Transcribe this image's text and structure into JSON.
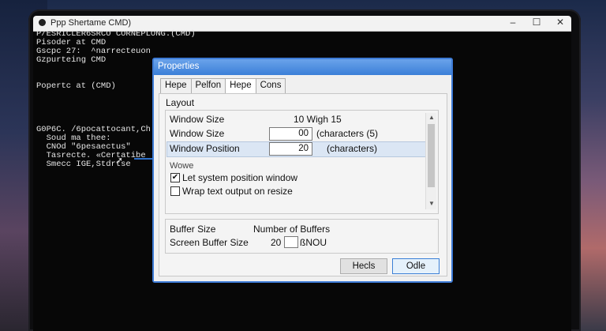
{
  "cmd_window": {
    "title": "Ppp Shertame CMD)",
    "controls": {
      "minimize": "–",
      "maximize": "☐",
      "close": "✕"
    },
    "console_lines": [
      "P/ESRICLER6SRCO CORNEPLONG.(CMD)",
      "Pisoder at CMD",
      "Gscpc 27:  ^narrecteuon",
      "Gzpurteing CMD",
      "",
      "",
      "Popertc at (CMD)",
      "",
      "",
      "",
      "",
      "G0P6C. /6pocattocant,Ch",
      "  Soud ma thee:",
      "  CNOd \"6pesaectus\"",
      "  Tasrecte. «Certatibe",
      "  Smecc IGE,Stdrtse"
    ]
  },
  "dialog": {
    "title": "Properties",
    "tabs": [
      "Hepe",
      "Pelfon",
      "Hepe",
      "Cons"
    ],
    "layout_label": "Layout",
    "rows": [
      {
        "label": "Window Size",
        "value": "10 Wigh 15"
      },
      {
        "label": "Window Size",
        "field": "00",
        "suffix": "(characters (5)"
      },
      {
        "label": "Window Position",
        "field": "20",
        "suffix": "(characters)"
      }
    ],
    "group_label": "Wowe",
    "checkboxes": [
      {
        "label": "Let system position window",
        "checked": true
      },
      {
        "label": "Wrap text output on resize",
        "checked": false
      }
    ],
    "buffer": {
      "buffer_size_label": "Buffer Size",
      "number_label": "Number of Buffers",
      "screen_label": "Screen Buffer Size",
      "screen_value": "20",
      "screen_unit": "ßNOU"
    },
    "buttons": {
      "help": "Hecls",
      "ok": "Odle"
    }
  },
  "colors": {
    "accent": "#3d7bd6",
    "highlight": "#dbe6f4"
  }
}
